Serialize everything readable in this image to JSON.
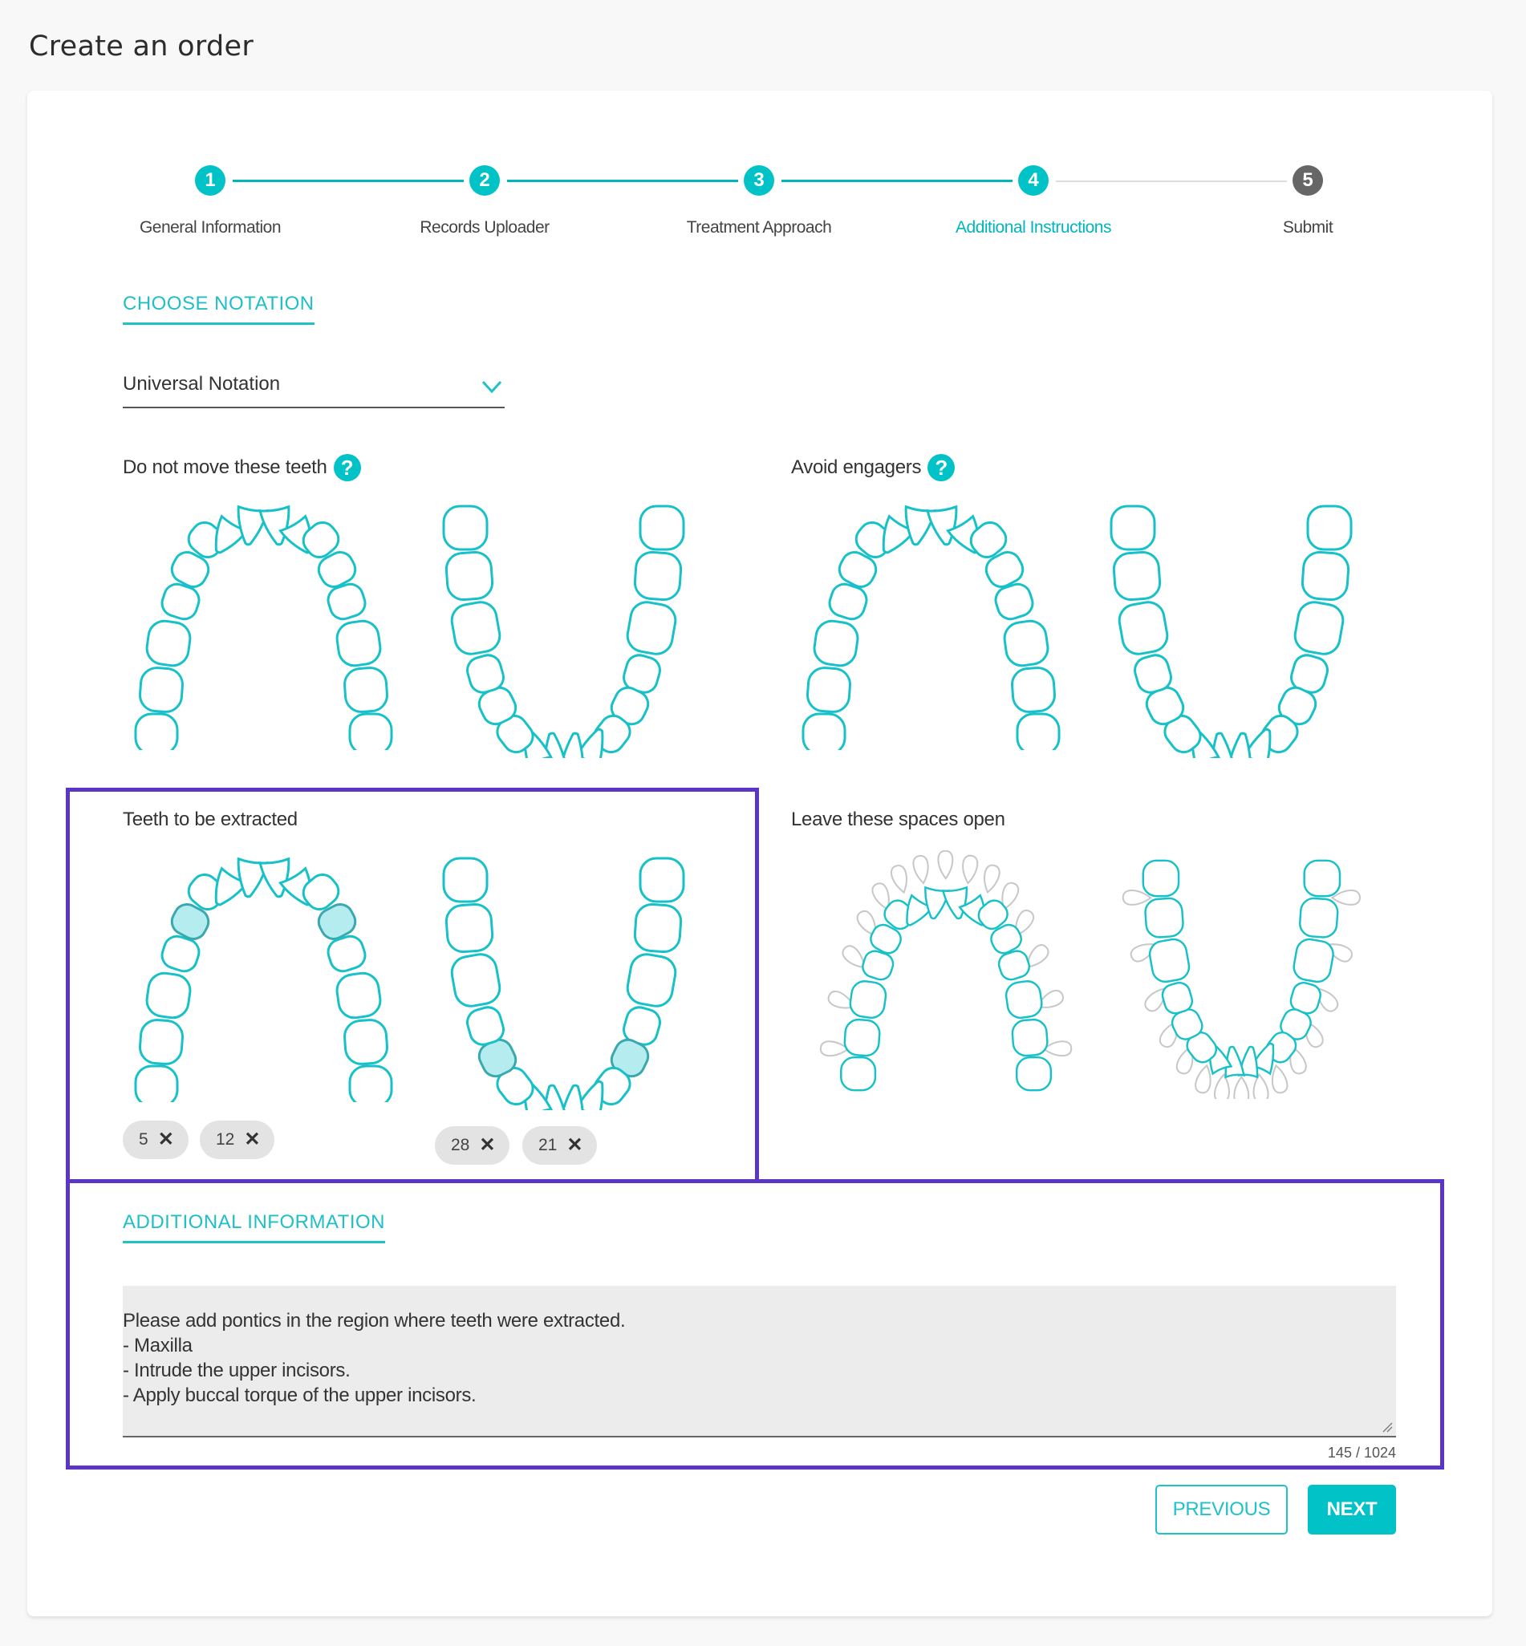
{
  "page": {
    "title": "Create an order"
  },
  "stepper": {
    "steps": [
      {
        "number": "1",
        "label": "General Information",
        "state": "complete"
      },
      {
        "number": "2",
        "label": "Records Uploader",
        "state": "complete"
      },
      {
        "number": "3",
        "label": "Treatment Approach",
        "state": "complete"
      },
      {
        "number": "4",
        "label": "Additional Instructions",
        "state": "active"
      },
      {
        "number": "5",
        "label": "Submit",
        "state": "pending"
      }
    ]
  },
  "notation": {
    "section_title": "CHOOSE NOTATION",
    "selected": "Universal Notation"
  },
  "tooth_groups": {
    "do_not_move": {
      "label": "Do not move these teeth",
      "has_help": true,
      "selected_teeth": []
    },
    "avoid_engagers": {
      "label": "Avoid engagers",
      "has_help": true,
      "selected_teeth": []
    },
    "extract": {
      "label": "Teeth to be extracted",
      "selected_teeth": [
        5,
        12,
        28,
        21
      ],
      "upper_chips": [
        "5",
        "12"
      ],
      "lower_chips": [
        "28",
        "21"
      ]
    },
    "spaces_open": {
      "label": "Leave these spaces open",
      "selected_spaces": []
    }
  },
  "additional_info": {
    "section_title": "ADDITIONAL INFORMATION",
    "text": "Please add pontics in the region where teeth were extracted.\n- Maxilla\n- Intrude the upper incisors.\n- Apply buccal torque of the upper incisors.",
    "counter": "145 / 1024"
  },
  "buttons": {
    "previous": "PREVIOUS",
    "next": "NEXT"
  },
  "colors": {
    "accent": "#00c2c7",
    "pending_step": "#666666",
    "highlight": "#5b35c5",
    "selected_tooth": "#b4ecef"
  }
}
